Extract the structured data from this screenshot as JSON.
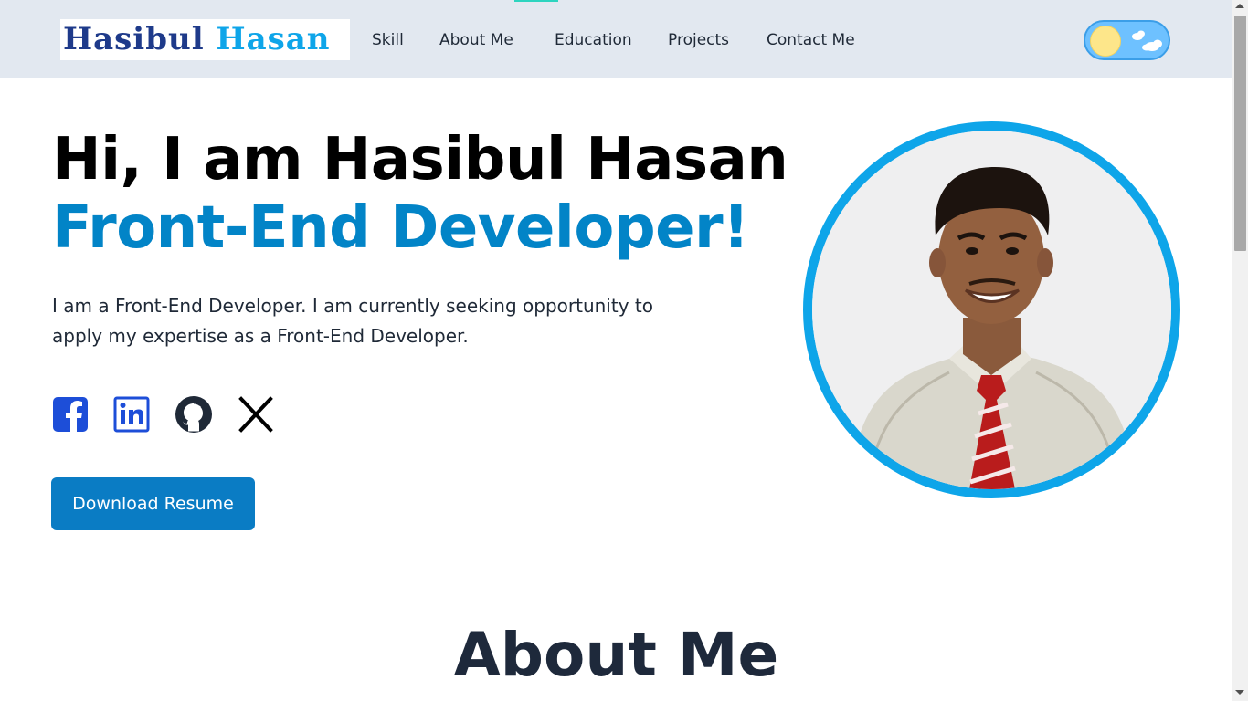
{
  "header": {
    "logo_text": {
      "first": "Hasibul",
      "second": "Hasan"
    },
    "nav": [
      {
        "label": "Skill"
      },
      {
        "label": "About Me"
      },
      {
        "label": "Education"
      },
      {
        "label": "Projects"
      },
      {
        "label": "Contact Me"
      }
    ],
    "theme_toggle": {
      "state": "light",
      "icons": [
        "sun-icon",
        "cloud-icon"
      ]
    }
  },
  "hero": {
    "greeting": "Hi, I am Hasibul Hasan",
    "role": "Front-End Developer!",
    "description": "I am a Front-End Developer. I am currently seeking opportunity to apply my expertise as a Front-End Developer.",
    "socials": [
      {
        "icon": "facebook-icon"
      },
      {
        "icon": "linkedin-icon"
      },
      {
        "icon": "github-icon"
      },
      {
        "icon": "x-icon"
      }
    ],
    "resume_button": "Download Resume",
    "photo": {
      "subject": "profile-photo"
    }
  },
  "about": {
    "title": "About Me"
  },
  "colors": {
    "accent": "#0284c7",
    "button": "#0a7cc4",
    "photo_ring": "#0ea5e9",
    "navbar_bg": "#e2e8f0",
    "social_blue": "#1d4ed8"
  }
}
